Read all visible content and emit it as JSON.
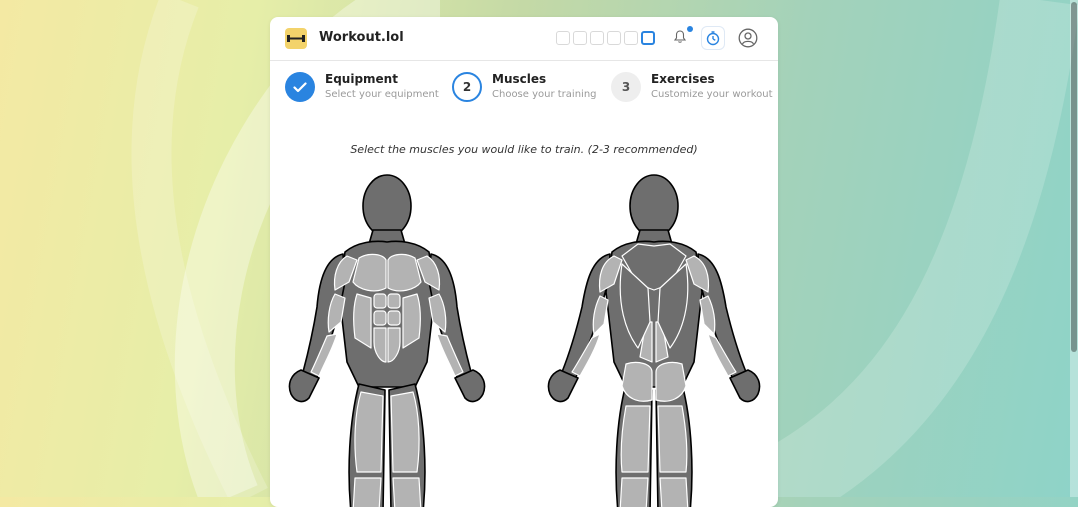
{
  "header": {
    "app_title": "Workout.lol",
    "logo_icon": "dumbbell-icon",
    "accent_color": "#2a84e0",
    "brand_color": "#f3d36b"
  },
  "steps": [
    {
      "number": "",
      "title": "Equipment",
      "subtitle": "Select your equipment",
      "state": "done"
    },
    {
      "number": "2",
      "title": "Muscles",
      "subtitle": "Choose your training",
      "state": "current"
    },
    {
      "number": "3",
      "title": "Exercises",
      "subtitle": "Customize your workout",
      "state": "todo"
    }
  ],
  "main": {
    "instruction": "Select the muscles you would like to train. (2-3 recommended)",
    "muscle_color": "#b3b3b3",
    "selected_muscle_color": "#6e6e6e"
  }
}
